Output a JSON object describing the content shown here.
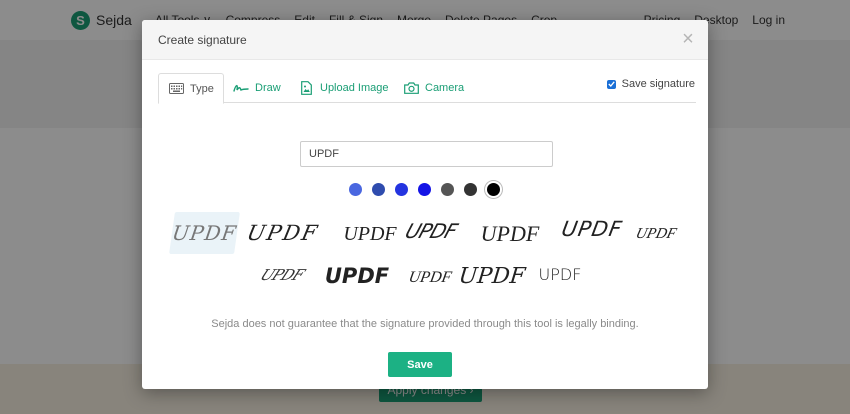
{
  "app": {
    "name": "Sejda",
    "logo_letter": "S",
    "brand_color": "#1a9e75"
  },
  "nav": {
    "items": [
      "All Tools ∨",
      "Compress",
      "Edit",
      "Fill & Sign",
      "Merge",
      "Delete Pages",
      "Crop"
    ],
    "right_items": [
      "Pricing",
      "Desktop",
      "Log in"
    ]
  },
  "background": {
    "apply_label": "Apply changes ›"
  },
  "modal": {
    "title": "Create signature",
    "close_label": "×",
    "tabs": [
      {
        "label": "Type",
        "icon": "keyboard-icon",
        "active": true
      },
      {
        "label": "Draw",
        "icon": "signature-draw-icon",
        "active": false
      },
      {
        "label": "Upload Image",
        "icon": "upload-image-icon",
        "active": false
      },
      {
        "label": "Camera",
        "icon": "camera-icon",
        "active": false
      }
    ],
    "save_signature": {
      "label": "Save signature",
      "checked": true
    },
    "input": {
      "value": "UPDF",
      "placeholder": ""
    },
    "colors": [
      "#4a67e0",
      "#2f4cae",
      "#2434e0",
      "#1414e6",
      "#555555",
      "#333333",
      "#000000"
    ],
    "selected_color": "#000000",
    "signatures": [
      {
        "text": "UPDF",
        "selected": true
      },
      {
        "text": "UPDF",
        "selected": false
      },
      {
        "text": "UPDF",
        "selected": false
      },
      {
        "text": "UPDF",
        "selected": false
      },
      {
        "text": "UPDF",
        "selected": false
      },
      {
        "text": "UPDF",
        "selected": false
      },
      {
        "text": "UPDF",
        "selected": false
      },
      {
        "text": "UPDF",
        "selected": false
      },
      {
        "text": "UPDF",
        "selected": false
      },
      {
        "text": "UPDF",
        "selected": false
      },
      {
        "text": "UPDF",
        "selected": false
      },
      {
        "text": "UPDF",
        "selected": false
      }
    ],
    "disclaimer": "Sejda does not guarantee that the signature provided through this tool is legally binding.",
    "save_label": "Save"
  }
}
